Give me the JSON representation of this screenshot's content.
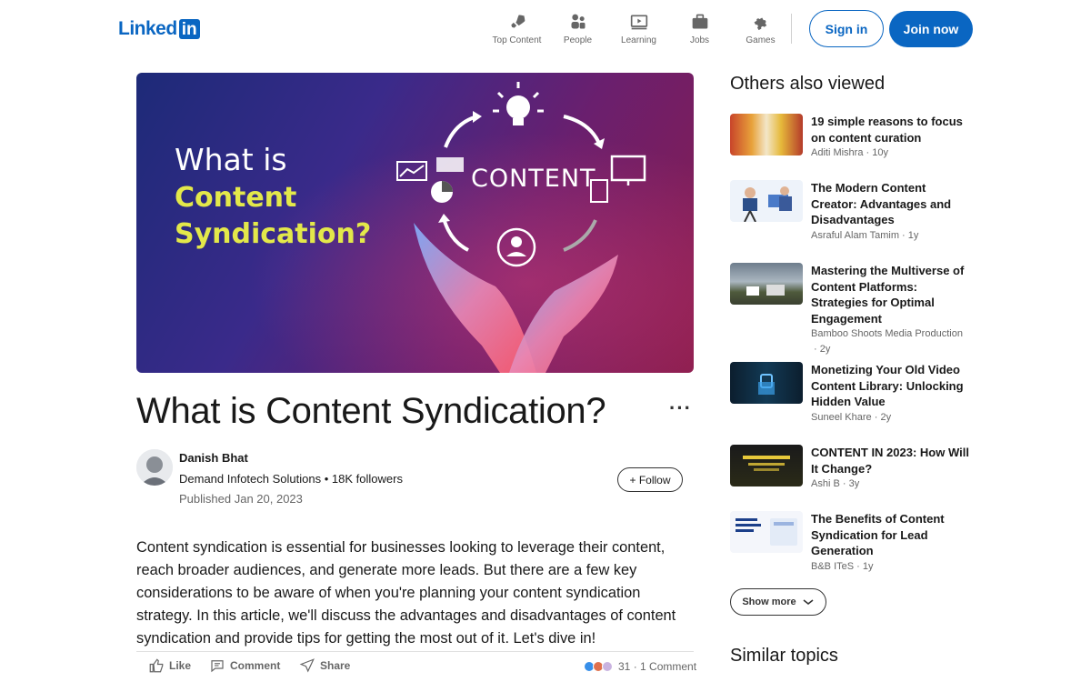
{
  "header": {
    "logo_text": "Linked",
    "logo_box": "in",
    "nav": [
      {
        "label": "Top Content",
        "icon": "rocket-icon"
      },
      {
        "label": "People",
        "icon": "people-icon"
      },
      {
        "label": "Learning",
        "icon": "video-icon"
      },
      {
        "label": "Jobs",
        "icon": "briefcase-icon"
      },
      {
        "label": "Games",
        "icon": "puzzle-icon"
      }
    ],
    "sign_in": "Sign in",
    "join_now": "Join now"
  },
  "hero": {
    "line1": "What is",
    "line2": "Content",
    "line3": "Syndication?",
    "center_word": "CONTENT"
  },
  "article": {
    "title": "What is Content Syndication?",
    "more": "···",
    "author_name": "Danish Bhat",
    "author_org": "Demand Infotech Solutions",
    "followers": "18K followers",
    "published": "Published Jan 20, 2023",
    "follow_label": "+ Follow",
    "body": "Content syndication is essential for businesses looking to leverage their content, reach broader audiences, and generate more leads. But there are a few key considerations to be aware of when you're planning your content syndication strategy. In this article, we'll discuss the advantages and disadvantages of content syndication and provide tips for getting the most out of it. Let's dive in!"
  },
  "actions": {
    "like": "Like",
    "comment": "Comment",
    "share": "Share",
    "reactions_count": "31",
    "comments_count": "1 Comment"
  },
  "sidebar": {
    "title": "Others also viewed",
    "items": [
      {
        "title": "19 simple reasons to focus on content curation",
        "author": "Aditi Mishra",
        "age": "10y"
      },
      {
        "title": "The Modern Content Creator: Advantages and Disadvantages",
        "author": "Asraful Alam Tamim",
        "age": "1y"
      },
      {
        "title": "Mastering the Multiverse of Content Platforms: Strategies for Optimal Engagement",
        "author": "Bamboo Shoots Media Production",
        "age": "2y"
      },
      {
        "title": "Monetizing Your Old Video Content Library: Unlocking Hidden Value",
        "author": "Suneel Khare",
        "age": "2y"
      },
      {
        "title": "CONTENT IN 2023: How Will It Change?",
        "author": "Ashi B",
        "age": "3y"
      },
      {
        "title": "The Benefits of Content Syndication for Lead Generation",
        "author": "B&B ITeS",
        "age": "1y"
      }
    ],
    "show_more": "Show more",
    "similar_topics": "Similar topics"
  },
  "colors": {
    "brand": "#0a66c2",
    "hero_accent": "#e3e84a"
  }
}
